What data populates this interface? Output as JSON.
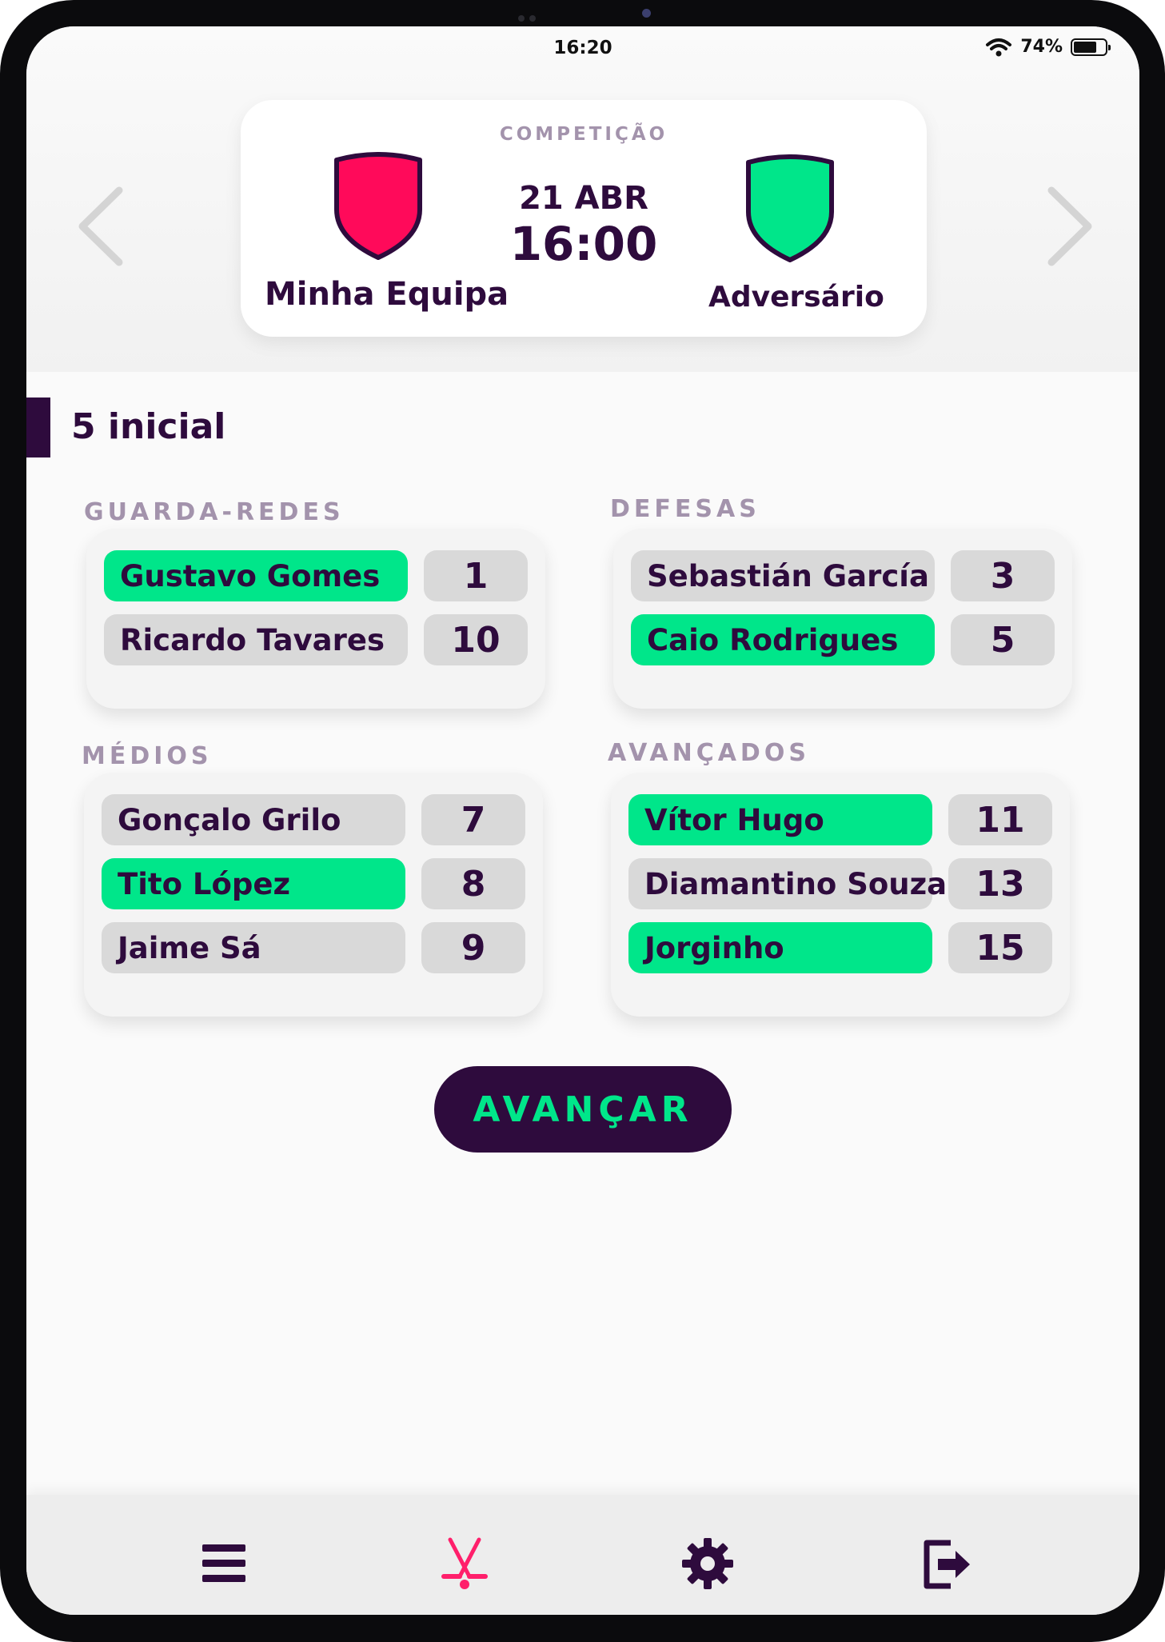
{
  "status_bar": {
    "time": "16:20",
    "battery_pct": "74%"
  },
  "match": {
    "competition": "COMPETIÇÃO",
    "date": "21 ABR",
    "time": "16:00",
    "home_team": "Minha Equipa",
    "away_team": "Adversário",
    "home_color": "#ff0a5a",
    "away_color": "#00e68a"
  },
  "section": {
    "title": "5 inicial"
  },
  "groups": {
    "goalkeepers": {
      "label": "GUARDA-REDES",
      "players": [
        {
          "name": "Gustavo Gomes",
          "number": "1",
          "selected": true
        },
        {
          "name": "Ricardo Tavares",
          "number": "10",
          "selected": false
        }
      ]
    },
    "defenders": {
      "label": "DEFESAS",
      "players": [
        {
          "name": "Sebastián García",
          "number": "3",
          "selected": false
        },
        {
          "name": "Caio Rodrigues",
          "number": "5",
          "selected": true
        }
      ]
    },
    "midfielders": {
      "label": "MÉDIOS",
      "players": [
        {
          "name": "Gonçalo Grilo",
          "number": "7",
          "selected": false
        },
        {
          "name": "Tito López",
          "number": "8",
          "selected": true
        },
        {
          "name": "Jaime Sá",
          "number": "9",
          "selected": false
        }
      ]
    },
    "forwards": {
      "label": "AVANÇADOS",
      "players": [
        {
          "name": "Vítor Hugo",
          "number": "11",
          "selected": true
        },
        {
          "name": "Diamantino Souza",
          "number": "13",
          "selected": false
        },
        {
          "name": "Jorginho",
          "number": "15",
          "selected": true
        }
      ]
    }
  },
  "advance_button": {
    "label": "AVANÇAR"
  },
  "tabs": [
    {
      "icon": "menu-icon"
    },
    {
      "icon": "hockey-sticks-icon",
      "active": true
    },
    {
      "icon": "gear-icon"
    },
    {
      "icon": "logout-icon"
    }
  ],
  "colors": {
    "primary": "#2e0b3d",
    "accent": "#00e68a",
    "active_tab": "#ff1f6b",
    "muted_label": "#a393ac"
  }
}
